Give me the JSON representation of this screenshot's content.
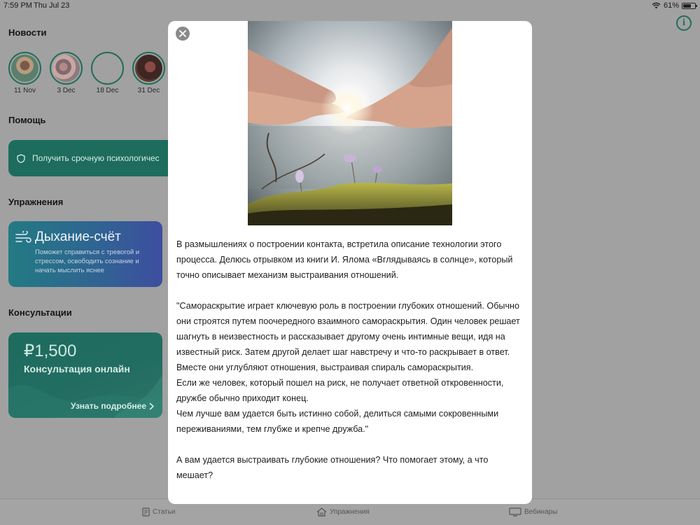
{
  "status": {
    "time": "7:59 PM",
    "date": "Thu Jul 23",
    "battery": "61%",
    "battery_level": 0.61
  },
  "news": {
    "title": "Новости",
    "stories": [
      {
        "label": "11 Nov"
      },
      {
        "label": "3 Dec"
      },
      {
        "label": "18 Dec"
      },
      {
        "label": "31 Dec"
      }
    ]
  },
  "help": {
    "title": "Помощь",
    "card_text": "Получить срочную психологичес"
  },
  "exercises": {
    "title": "Упражнения",
    "card_title": "Дыхание-счёт",
    "card_desc": "Поможет справиться с тревогой и стрессом, освободить сознание и начать мыслить яснее"
  },
  "consultations": {
    "title": "Консультации",
    "price": "₽1,500",
    "name": "Консультация онлайн",
    "more": "Узнать подробнее"
  },
  "tabs": [
    {
      "label": "Статьи",
      "icon": "doc-icon"
    },
    {
      "label": "Упражнения",
      "icon": "home-icon"
    },
    {
      "label": "Вебинары",
      "icon": "monitor-icon"
    }
  ],
  "modal": {
    "close_icon": "close-icon",
    "paragraphs": [
      "В размышлениях о построении контакта, встретила описание технологии этого процесса. Делюсь отрывком из книги И. Ялома «Вглядываясь в солнце», который точно описывает механизм выстраивания отношений.",
      "\"Самораскрытие играет ключевую роль в построении глубоких отношений. Обычно они строятся путем поочередного взаимного самораскрытия. Один человек решает шагнуть в неизвестность и рассказывает другому очень интимные вещи, идя на известный риск. Затем другой делает шаг навстречу и что-то раскрывает в ответ. Вместе они углубляют отношения, выстраивая спираль самораскрытия.",
      "Если же человек, который пошел на риск, не получает ответной откровенности, дружбе обычно приходит конец.",
      "Чем лучше вам удается быть истинно собой, делиться самыми сокровенными переживаниями, тем глубже и крепче дружба.\"",
      "А вам удается выстраивать глубокие отношения? Что помогает этому, а что мешает?"
    ]
  }
}
